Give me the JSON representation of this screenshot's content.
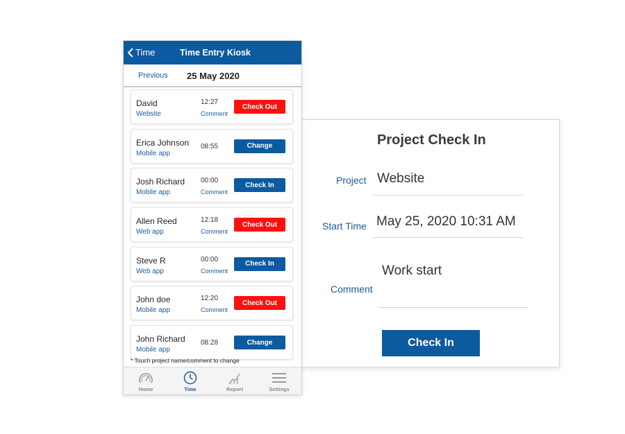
{
  "colors": {
    "accent": "#0c5aa0",
    "checkout": "#ff1010",
    "link": "#1a5a9c"
  },
  "phone": {
    "header": {
      "back_label": "Time",
      "title": "Time Entry Kiosk"
    },
    "date_bar": {
      "previous_label": "Previous",
      "date": "25 May 2020"
    },
    "entries": [
      {
        "name": "David",
        "project": "Website",
        "time": "12:27",
        "comment": "Comment",
        "action": "Check Out",
        "action_type": "checkout"
      },
      {
        "name": "Erica Johnson",
        "project": "Mobile app",
        "time": "08:55",
        "comment": "",
        "action": "Change",
        "action_type": "change"
      },
      {
        "name": "Josh Richard",
        "project": "Mobile app",
        "time": "00:00",
        "comment": "Comment",
        "action": "Check In",
        "action_type": "checkin"
      },
      {
        "name": "Allen Reed",
        "project": "Web app",
        "time": "12:18",
        "comment": "Comment",
        "action": "Check Out",
        "action_type": "checkout"
      },
      {
        "name": "Steve R",
        "project": "Web app",
        "time": "00:00",
        "comment": "Comment",
        "action": "Check In",
        "action_type": "checkin"
      },
      {
        "name": "John doe",
        "project": "Mobile app",
        "time": "12:20",
        "comment": "Comment",
        "action": "Check Out",
        "action_type": "checkout"
      },
      {
        "name": "John Richard",
        "project": "Mobile app",
        "time": "08:28",
        "comment": "",
        "action": "Change",
        "action_type": "change"
      }
    ],
    "note": "* Touch project name/comment to change",
    "tabs": [
      {
        "label": "Home",
        "icon": "speedometer-icon",
        "active": false
      },
      {
        "label": "Time",
        "icon": "clock-icon",
        "active": true
      },
      {
        "label": "Report",
        "icon": "report-chart-icon",
        "active": false
      },
      {
        "label": "Settings",
        "icon": "menu-icon",
        "active": false
      }
    ]
  },
  "check_in_panel": {
    "title": "Project Check In",
    "project_label": "Project",
    "project_value": "Website",
    "start_time_label": "Start Time",
    "start_time_value": "May 25, 2020 10:31 AM",
    "comment_label": "Comment",
    "comment_value": "Work start",
    "button_label": "Check In"
  }
}
